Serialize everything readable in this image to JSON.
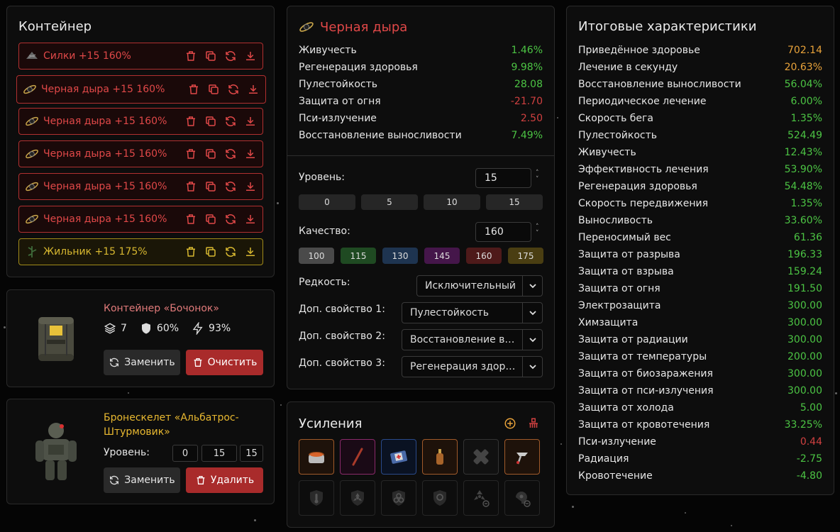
{
  "container": {
    "title": "Контейнер",
    "items": [
      {
        "label": "Силки +15 160%",
        "tier": "red"
      },
      {
        "label": "Черная дыра +15 160%",
        "tier": "red"
      },
      {
        "label": "Черная дыра +15 160%",
        "tier": "red"
      },
      {
        "label": "Черная дыра +15 160%",
        "tier": "red"
      },
      {
        "label": "Черная дыра +15 160%",
        "tier": "red"
      },
      {
        "label": "Черная дыра +15 160%",
        "tier": "red"
      },
      {
        "label": "Жильник +15 175%",
        "tier": "gold"
      }
    ]
  },
  "barrel": {
    "name": "Контейнер «Бочонок»",
    "slots": "7",
    "protection": "60%",
    "efficiency": "93%",
    "replace_label": "Заменить",
    "clear_label": "Очистить"
  },
  "armor": {
    "name": "Бронескелет «Альбатрос-Штурмовик»",
    "level_label": "Уровень:",
    "levels": [
      "0",
      "15",
      "15"
    ],
    "replace_label": "Заменить",
    "delete_label": "Удалить"
  },
  "artifact": {
    "title": "Черная дыра",
    "stats": [
      {
        "name": "Живучесть",
        "value": "1.46%",
        "c": "g"
      },
      {
        "name": "Регенерация здоровья",
        "value": "9.98%",
        "c": "g"
      },
      {
        "name": "Пулестойкость",
        "value": "28.08",
        "c": "g"
      },
      {
        "name": "Защита от огня",
        "value": "-21.70",
        "c": "r"
      },
      {
        "name": "Пси-излучение",
        "value": "2.50",
        "c": "r"
      },
      {
        "name": "Восстановление выносливости",
        "value": "7.49%",
        "c": "g"
      }
    ],
    "level_label": "Уровень:",
    "level_value": "15",
    "level_presets": [
      "0",
      "5",
      "10",
      "15"
    ],
    "quality_label": "Качество:",
    "quality_value": "160",
    "quality_presets": [
      {
        "v": "100",
        "color": "#4a4a4a"
      },
      {
        "v": "115",
        "color": "#1f4a22"
      },
      {
        "v": "130",
        "color": "#1e3450"
      },
      {
        "v": "145",
        "color": "#45164a"
      },
      {
        "v": "160",
        "color": "#4e1a1a"
      },
      {
        "v": "175",
        "color": "#4a3e12"
      }
    ],
    "rarity_label": "Редкость:",
    "rarity_value": "Исключительный",
    "prop1_label": "Доп. свойство 1:",
    "prop1_value": "Пулестойкость",
    "prop2_label": "Доп. свойство 2:",
    "prop2_value": "Восстановление выносливости",
    "prop3_label": "Доп. свойство 3:",
    "prop3_value": "Регенерация здоровья"
  },
  "boosts": {
    "title": "Усиления"
  },
  "totals": {
    "title": "Итоговые характеристики",
    "stats": [
      {
        "name": "Приведённое здоровье",
        "value": "702.14",
        "c": "o"
      },
      {
        "name": "Лечение в секунду",
        "value": "20.63%",
        "c": "o"
      },
      {
        "name": "Восстановление выносливости",
        "value": "56.04%",
        "c": "g"
      },
      {
        "name": "Периодическое лечение",
        "value": "6.00%",
        "c": "g"
      },
      {
        "name": "Скорость бега",
        "value": "1.35%",
        "c": "g"
      },
      {
        "name": "Пулестойкость",
        "value": "524.49",
        "c": "g"
      },
      {
        "name": "Живучесть",
        "value": "12.43%",
        "c": "g"
      },
      {
        "name": "Эффективность лечения",
        "value": "53.90%",
        "c": "g"
      },
      {
        "name": "Регенерация здоровья",
        "value": "54.48%",
        "c": "g"
      },
      {
        "name": "Скорость передвижения",
        "value": "1.35%",
        "c": "g"
      },
      {
        "name": "Выносливость",
        "value": "33.60%",
        "c": "g"
      },
      {
        "name": "Переносимый вес",
        "value": "61.36",
        "c": "g"
      },
      {
        "name": "Защита от разрыва",
        "value": "196.33",
        "c": "g"
      },
      {
        "name": "Защита от взрыва",
        "value": "159.24",
        "c": "g"
      },
      {
        "name": "Защита от огня",
        "value": "191.50",
        "c": "g"
      },
      {
        "name": "Электрозащита",
        "value": "300.00",
        "c": "g"
      },
      {
        "name": "Химзащита",
        "value": "300.00",
        "c": "g"
      },
      {
        "name": "Защита от радиации",
        "value": "300.00",
        "c": "g"
      },
      {
        "name": "Защита от температуры",
        "value": "200.00",
        "c": "g"
      },
      {
        "name": "Защита от биозаражения",
        "value": "300.00",
        "c": "g"
      },
      {
        "name": "Защита от пси-излучения",
        "value": "300.00",
        "c": "g"
      },
      {
        "name": "Защита от холода",
        "value": "5.00",
        "c": "g"
      },
      {
        "name": "Защита от кровотечения",
        "value": "33.25%",
        "c": "g"
      },
      {
        "name": "Пси-излучение",
        "value": "0.44",
        "c": "r"
      },
      {
        "name": "Радиация",
        "value": "-2.75",
        "c": "g"
      },
      {
        "name": "Кровотечение",
        "value": "-4.80",
        "c": "g"
      }
    ]
  }
}
